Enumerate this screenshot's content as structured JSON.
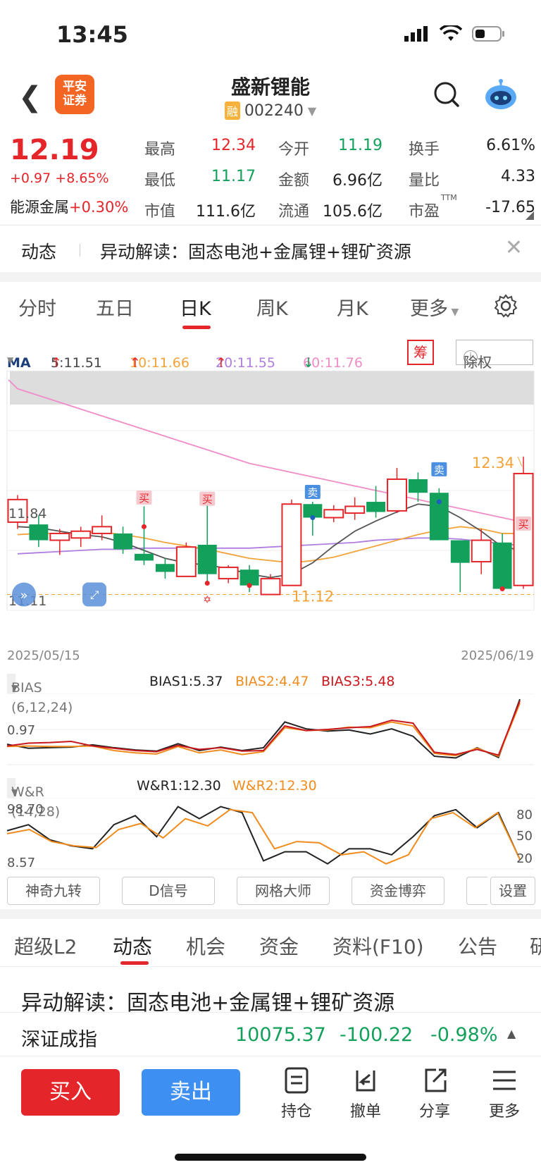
{
  "status_bar": {
    "time": "13:45"
  },
  "header": {
    "back_icon": "chevron-left-icon",
    "logo_text": [
      "平安",
      "证券"
    ],
    "stock_name": "盛新锂能",
    "margin_badge": "融",
    "stock_code": "002240"
  },
  "quote": {
    "price": "12.19",
    "change": "+0.97",
    "change_pct": "+8.65%",
    "sector_name": "能源金属",
    "sector_change": "+0.30%",
    "fields": [
      [
        {
          "label": "最高",
          "value": "12.34",
          "color": "red"
        },
        {
          "label": "今开",
          "value": "11.19",
          "color": "green"
        },
        {
          "label": "换手",
          "value": "6.61%",
          "color": "black"
        }
      ],
      [
        {
          "label": "最低",
          "value": "11.17",
          "color": "green"
        },
        {
          "label": "金额",
          "value": "6.96亿",
          "color": "black"
        },
        {
          "label": "量比",
          "value": "4.33",
          "color": "black"
        }
      ],
      [
        {
          "label": "市值",
          "value": "111.6亿",
          "color": "black"
        },
        {
          "label": "流通",
          "value": "105.6亿",
          "color": "black"
        },
        {
          "label": "市盈",
          "value": "-17.65",
          "color": "black",
          "sup": "TTM"
        }
      ]
    ]
  },
  "news_bar": {
    "tag": "动态",
    "text": "异动解读：固态电池+金属锂+锂矿资源"
  },
  "chart_tabs": [
    "分时",
    "五日",
    "日K",
    "周K",
    "月K",
    "更多"
  ],
  "chart_tabs_active": 2,
  "ma_legend": {
    "label": "MA",
    "items": [
      {
        "text": "5:11.51",
        "color": "#444444",
        "dir": "↑",
        "dir_color": "#e4262b"
      },
      {
        "text": "10:11.66",
        "color": "#f2a33a",
        "dir": "↑",
        "dir_color": "#e4262b"
      },
      {
        "text": "20:11.55",
        "color": "#b07ee0",
        "dir": "↑",
        "dir_color": "#e4262b"
      },
      {
        "text": "60:11.76",
        "color": "#f08cc6",
        "dir": "↓",
        "dir_color": "#13a05b"
      }
    ],
    "chips_button": "筹",
    "exrights_button": "除权"
  },
  "chart_data": [
    {
      "type": "candlestick",
      "x_start_label": "2025/05/15",
      "x_end_label": "2025/06/19",
      "y_tick_labels": [
        "11.84",
        "11.11"
      ],
      "high_marker": "12.34",
      "low_marker": "11.12",
      "y_range": [
        10.98,
        13.1
      ],
      "candles": [
        {
          "o": 11.76,
          "c": 11.96,
          "h": 12.0,
          "l": 11.7
        },
        {
          "o": 11.74,
          "c": 11.6,
          "h": 11.82,
          "l": 11.54
        },
        {
          "o": 11.6,
          "c": 11.66,
          "h": 11.7,
          "l": 11.47
        },
        {
          "o": 11.62,
          "c": 11.68,
          "h": 11.72,
          "l": 11.54
        },
        {
          "o": 11.66,
          "c": 11.72,
          "h": 11.82,
          "l": 11.6
        },
        {
          "o": 11.66,
          "c": 11.52,
          "h": 11.72,
          "l": 11.48
        },
        {
          "o": 11.48,
          "c": 11.42,
          "h": 11.9,
          "l": 11.38
        },
        {
          "o": 11.39,
          "c": 11.32,
          "h": 11.44,
          "l": 11.26
        },
        {
          "o": 11.28,
          "c": 11.54,
          "h": 11.58,
          "l": 11.28
        },
        {
          "o": 11.56,
          "c": 11.3,
          "h": 11.92,
          "l": 11.22
        },
        {
          "o": 11.26,
          "c": 11.36,
          "h": 11.38,
          "l": 11.22
        },
        {
          "o": 11.34,
          "c": 11.2,
          "h": 11.38,
          "l": 11.14
        },
        {
          "o": 11.12,
          "c": 11.26,
          "h": 11.3,
          "l": 11.12
        },
        {
          "o": 11.2,
          "c": 11.92,
          "h": 11.96,
          "l": 11.2
        },
        {
          "o": 11.92,
          "c": 11.8,
          "h": 11.94,
          "l": 11.64
        },
        {
          "o": 11.8,
          "c": 11.87,
          "h": 11.91,
          "l": 11.76
        },
        {
          "o": 11.84,
          "c": 11.9,
          "h": 11.98,
          "l": 11.78
        },
        {
          "o": 11.94,
          "c": 11.85,
          "h": 12.08,
          "l": 11.8
        },
        {
          "o": 11.86,
          "c": 12.14,
          "h": 12.24,
          "l": 11.84
        },
        {
          "o": 12.14,
          "c": 12.02,
          "h": 12.2,
          "l": 11.94
        },
        {
          "o": 12.02,
          "c": 11.6,
          "h": 12.06,
          "l": 11.6
        },
        {
          "o": 11.6,
          "c": 11.4,
          "h": 11.6,
          "l": 11.14
        },
        {
          "o": 11.41,
          "c": 11.6,
          "h": 11.7,
          "l": 11.3
        },
        {
          "o": 11.58,
          "c": 11.17,
          "h": 11.66,
          "l": 11.17
        },
        {
          "o": 11.2,
          "c": 12.19,
          "h": 12.34,
          "l": 11.17
        }
      ],
      "ma5": [
        11.72,
        11.71,
        11.68,
        11.65,
        11.63,
        11.58,
        11.51,
        11.44,
        11.4,
        11.38,
        11.35,
        11.3,
        11.27,
        11.3,
        11.4,
        11.55,
        11.68,
        11.77,
        11.85,
        11.92,
        11.9,
        11.8,
        11.68,
        11.54,
        11.51
      ],
      "ma10": [
        11.65,
        11.66,
        11.66,
        11.67,
        11.67,
        11.65,
        11.62,
        11.58,
        11.55,
        11.52,
        11.48,
        11.44,
        11.42,
        11.4,
        11.42,
        11.45,
        11.5,
        11.55,
        11.6,
        11.65,
        11.69,
        11.72,
        11.7,
        11.66,
        11.66
      ],
      "ma20": [
        11.48,
        11.49,
        11.5,
        11.51,
        11.52,
        11.52,
        11.53,
        11.53,
        11.53,
        11.53,
        11.53,
        11.53,
        11.54,
        11.55,
        11.56,
        11.57,
        11.58,
        11.6,
        11.61,
        11.62,
        11.62,
        11.61,
        11.59,
        11.57,
        11.55
      ],
      "ma60": [
        12.94,
        12.88,
        12.82,
        12.76,
        12.7,
        12.64,
        12.58,
        12.52,
        12.46,
        12.4,
        12.34,
        12.28,
        12.24,
        12.2,
        12.16,
        12.12,
        12.08,
        12.04,
        12.0,
        11.96,
        11.92,
        11.88,
        11.84,
        11.8,
        11.76
      ],
      "signals": [
        {
          "i": 6,
          "text": "买",
          "kind": "buy",
          "price": 12.04
        },
        {
          "i": 9,
          "text": "买",
          "kind": "buy",
          "price": 12.03
        },
        {
          "i": 14,
          "text": "卖",
          "kind": "sell",
          "price": 12.09
        },
        {
          "i": 20,
          "text": "卖",
          "kind": "sell",
          "price": 12.29
        },
        {
          "i": 24,
          "text": "买",
          "kind": "buy",
          "price": 11.81
        }
      ],
      "shaded_band": [
        12.8,
        13.1
      ]
    },
    {
      "type": "line",
      "title": "BIAS (6,12,24)",
      "y_tick_label": "0.97",
      "series": [
        {
          "name": "BIAS1:5.37",
          "color": "#222222",
          "values": [
            1.6,
            0.9,
            1.0,
            1.1,
            1.5,
            1.0,
            0.6,
            0.4,
            1.7,
            0.5,
            1.1,
            0.5,
            1.0,
            5.5,
            4.3,
            3.9,
            4.1,
            3.4,
            4.3,
            3.0,
            -0.5,
            -0.8,
            1.0,
            -0.7,
            9.5
          ]
        },
        {
          "name": "BIAS2:4.47",
          "color": "#f08c1e",
          "values": [
            1.2,
            1.3,
            1.2,
            1.2,
            1.3,
            0.5,
            0.1,
            -0.1,
            1.2,
            0.1,
            0.6,
            -0.2,
            0.3,
            4.5,
            4.0,
            4.1,
            4.6,
            4.5,
            5.5,
            4.8,
            0.0,
            -0.4,
            0.9,
            -0.5,
            8.8
          ]
        },
        {
          "name": "BIAS3:5.48",
          "color": "#c8171e",
          "values": [
            1.3,
            1.8,
            1.9,
            2.1,
            1.3,
            0.9,
            0.5,
            0.3,
            1.4,
            0.7,
            1.0,
            0.4,
            0.5,
            4.8,
            4.0,
            4.2,
            4.5,
            4.7,
            5.8,
            5.3,
            0.2,
            -0.2,
            0.7,
            -0.3,
            9.2
          ]
        }
      ],
      "y_range": [
        -1.6,
        10.0
      ]
    },
    {
      "type": "line",
      "title": "W&R (14,28)",
      "y_tick_labels_left": [
        "98.70",
        "8.57"
      ],
      "y_tick_labels_right": [
        "80",
        "50",
        "20"
      ],
      "series": [
        {
          "name": "W&R1:12.30",
          "color": "#222222",
          "values": [
            60,
            70,
            45,
            35,
            30,
            70,
            85,
            50,
            100,
            80,
            100,
            90,
            10,
            25,
            25,
            5,
            30,
            30,
            20,
            50,
            85,
            95,
            65,
            90,
            12.3
          ]
        },
        {
          "name": "W&R2:12.30",
          "color": "#f08c1e",
          "values": [
            55,
            62,
            42,
            35,
            32,
            62,
            72,
            48,
            80,
            68,
            95,
            90,
            30,
            42,
            40,
            20,
            25,
            5,
            20,
            80,
            90,
            65,
            90,
            12.3
          ]
        }
      ],
      "y_range": [
        0,
        110
      ]
    }
  ],
  "tool_buttons": [
    "神奇九转",
    "D信号",
    "网格大师",
    "资金博弈",
    "设置"
  ],
  "bottom_tabs": [
    "超级L2",
    "动态",
    "机会",
    "资金",
    "资料(F10)",
    "公告",
    "研"
  ],
  "bottom_tabs_active": 1,
  "news_body": "异动解读：固态电池+金属锂+锂矿资源",
  "index_bar": {
    "name": "深证成指",
    "value": "10075.37",
    "change": "-100.22",
    "change_pct": "-0.98%"
  },
  "actions": {
    "buy": "买入",
    "sell": "卖出",
    "items": [
      {
        "label": "持仓",
        "icon": "holdings-icon"
      },
      {
        "label": "撤单",
        "icon": "cancel-order-icon"
      },
      {
        "label": "分享",
        "icon": "share-icon"
      },
      {
        "label": "更多",
        "icon": "more-icon"
      }
    ]
  },
  "colors": {
    "up": "#e4262b",
    "down": "#13a05b",
    "accent": "#3d8ff2"
  }
}
